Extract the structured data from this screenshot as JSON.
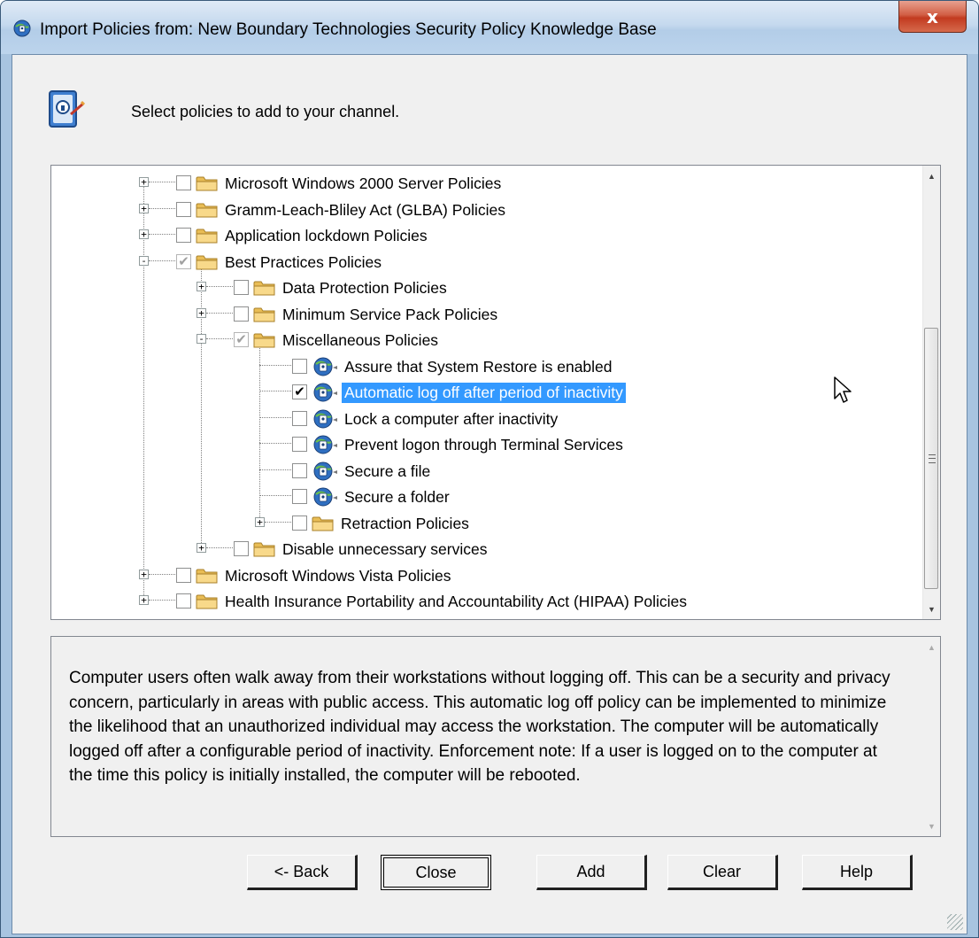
{
  "window": {
    "title": "Import Policies from: New Boundary Technologies Security Policy Knowledge Base",
    "close_label": "x"
  },
  "header": {
    "instruction": "Select policies to add to your channel."
  },
  "tree": {
    "items": [
      {
        "label": "Microsoft Windows 2000 Server Policies",
        "type": "folder",
        "level": 0,
        "expander": "+",
        "checked": false
      },
      {
        "label": "Gramm-Leach-Bliley Act (GLBA) Policies",
        "type": "folder",
        "level": 0,
        "expander": "+",
        "checked": false
      },
      {
        "label": "Application lockdown Policies",
        "type": "folder",
        "level": 0,
        "expander": "+",
        "checked": false
      },
      {
        "label": "Best Practices Policies",
        "type": "folder",
        "level": 0,
        "expander": "-",
        "checked": "partial"
      },
      {
        "label": "Data Protection Policies",
        "type": "folder",
        "level": 1,
        "expander": "+",
        "checked": false
      },
      {
        "label": "Minimum Service Pack Policies",
        "type": "folder",
        "level": 1,
        "expander": "+",
        "checked": false
      },
      {
        "label": "Miscellaneous Policies",
        "type": "folder",
        "level": 1,
        "expander": "-",
        "checked": "partial"
      },
      {
        "label": "Assure that System Restore is enabled",
        "type": "policy",
        "level": 2,
        "checked": false
      },
      {
        "label": "Automatic log off after period of inactivity",
        "type": "policy",
        "level": 2,
        "checked": true,
        "selected": true
      },
      {
        "label": "Lock a computer after inactivity",
        "type": "policy",
        "level": 2,
        "checked": false
      },
      {
        "label": "Prevent logon through Terminal Services",
        "type": "policy",
        "level": 2,
        "checked": false
      },
      {
        "label": "Secure a file",
        "type": "policy",
        "level": 2,
        "checked": false
      },
      {
        "label": "Secure a folder",
        "type": "policy",
        "level": 2,
        "checked": false
      },
      {
        "label": "Retraction Policies",
        "type": "folder",
        "level": 2,
        "expander": "+",
        "checked": false
      },
      {
        "label": "Disable unnecessary services",
        "type": "folder",
        "level": 1,
        "expander": "+",
        "checked": false
      },
      {
        "label": "Microsoft Windows Vista Policies",
        "type": "folder",
        "level": 0,
        "expander": "+",
        "checked": false
      },
      {
        "label": "Health Insurance Portability and Accountability Act (HIPAA) Policies",
        "type": "folder",
        "level": 0,
        "expander": "+",
        "checked": false
      }
    ]
  },
  "description": {
    "text": "Computer users often walk away from their workstations without logging off. This can be a security and privacy concern, particularly in areas with public access. This automatic log off policy can be implemented to minimize the likelihood that an unauthorized individual may access the workstation. The computer will be automatically logged off after a configurable period of inactivity. Enforcement note: If a user is logged on to the computer at the time this policy is initially installed, the computer will be rebooted."
  },
  "buttons": {
    "back": "<- Back",
    "close": "Close",
    "add": "Add",
    "clear": "Clear",
    "help": "Help"
  },
  "colors": {
    "selection": "#3399ff",
    "folder": "#f5d27a",
    "close_button": "#c9462b"
  },
  "icons": {
    "title": "policy-globe-icon",
    "header": "policy-header-icon",
    "folder": "folder-icon",
    "policy": "policy-globe-icon"
  }
}
